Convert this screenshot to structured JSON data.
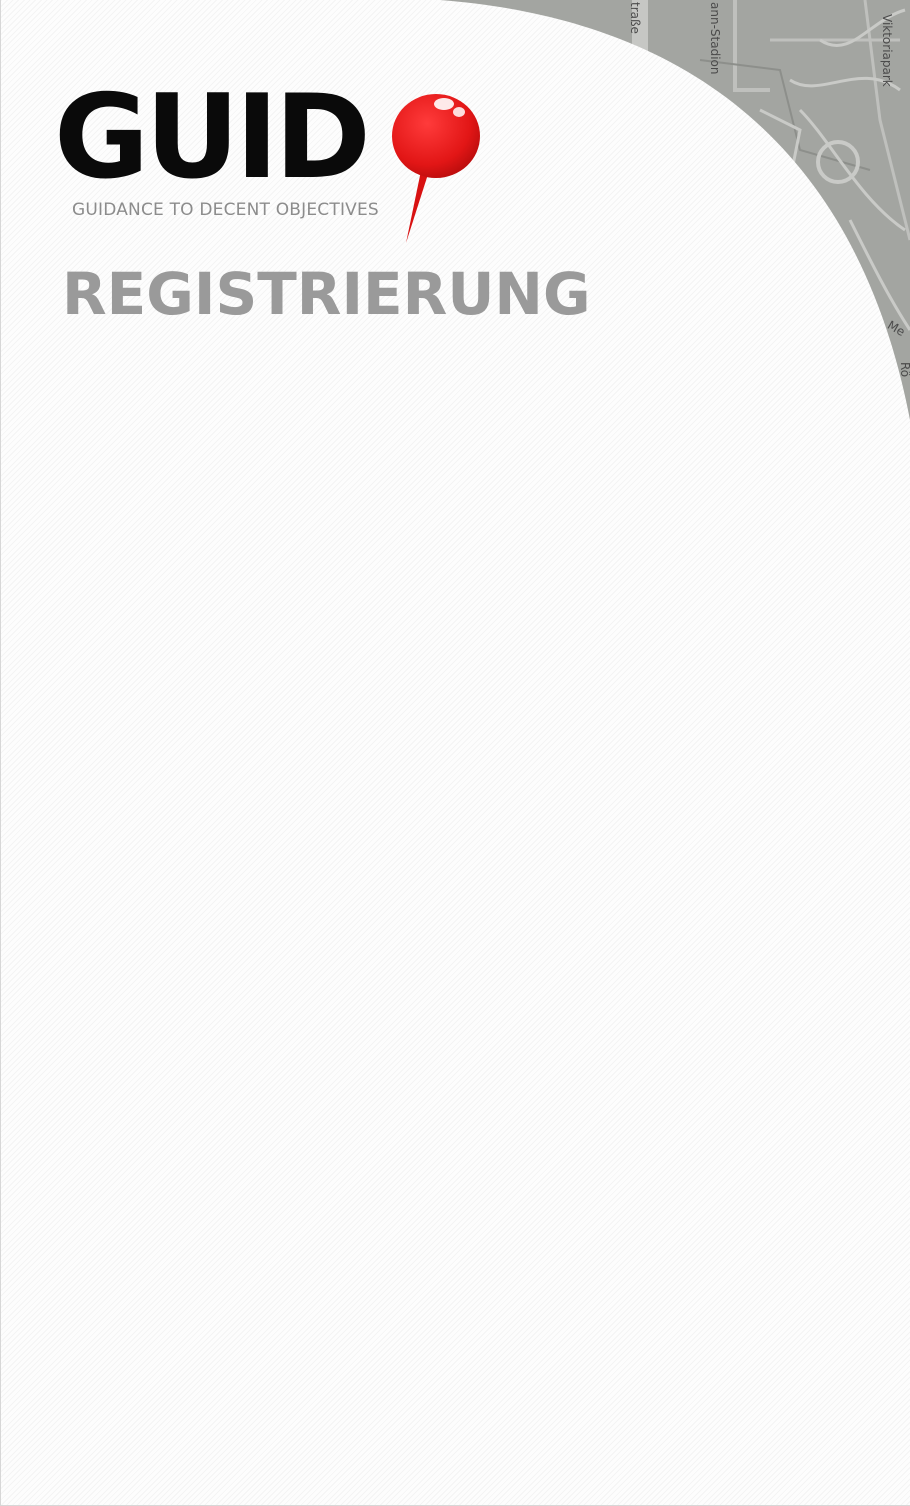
{
  "app": {
    "logo_word": "GUID",
    "tagline": "GUIDANCE TO DECENT OBJECTIVES"
  },
  "page": {
    "title": "REGISTRIERUNG"
  },
  "map": {
    "labels": {
      "strasse": "traße",
      "stadion": "ann-Stadion",
      "park": "Viktoriapark",
      "edge_1": "Me",
      "edge_2": "Rö"
    }
  },
  "colors": {
    "background": "#fdfdfd",
    "map": "#9b9d99",
    "logo_text": "#0a0a0a",
    "pin_red": "#e21616",
    "title_gray": "#9a9a9a",
    "tagline_gray": "#8c8c8c"
  },
  "icons": {
    "pin": "map-pin-icon"
  }
}
